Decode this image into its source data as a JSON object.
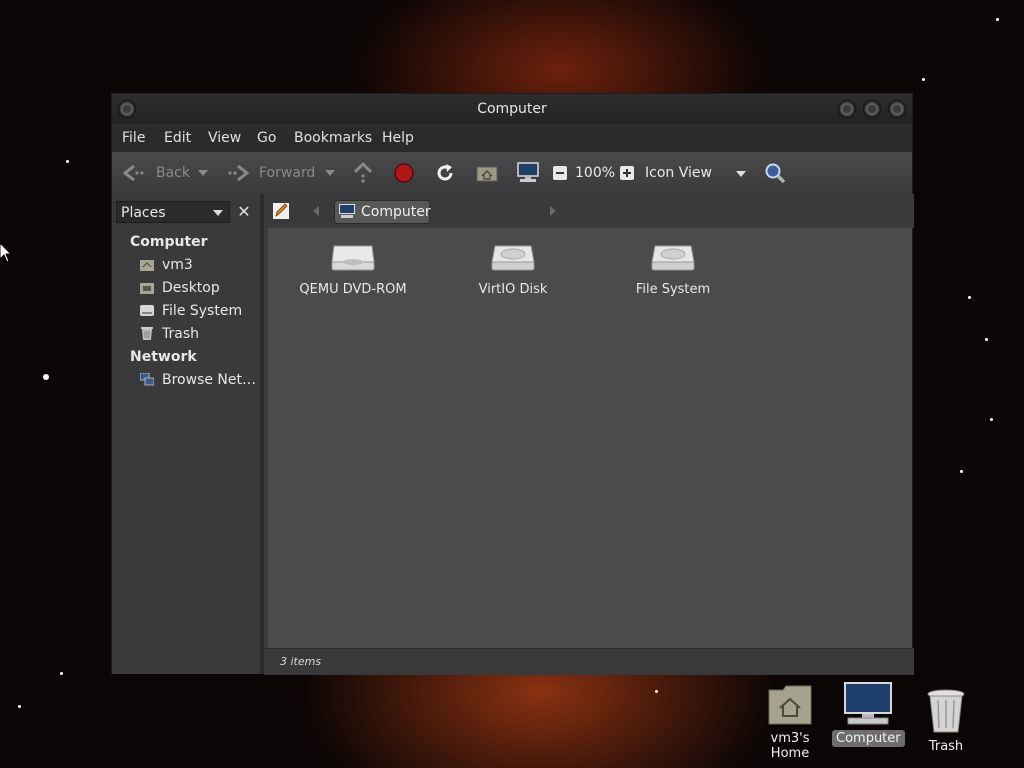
{
  "window": {
    "title": "Computer"
  },
  "menu": {
    "file": "File",
    "edit": "Edit",
    "view": "View",
    "go": "Go",
    "bookmarks": "Bookmarks",
    "help": "Help"
  },
  "toolbar": {
    "back": "Back",
    "forward": "Forward",
    "zoom": "100%",
    "view_mode": "Icon View"
  },
  "sidebar": {
    "selector_label": "Places",
    "section_computer": "Computer",
    "items_computer": [
      "vm3",
      "Desktop",
      "File System",
      "Trash"
    ],
    "section_network": "Network",
    "items_network": [
      "Browse Net…"
    ]
  },
  "pathbar": {
    "current": "Computer"
  },
  "content": {
    "items": [
      "QEMU DVD-ROM",
      "VirtIO Disk",
      "File System"
    ]
  },
  "status": {
    "count": "3 items"
  },
  "desktop": {
    "items": [
      "vm3's Home",
      "Computer",
      "Trash"
    ]
  }
}
